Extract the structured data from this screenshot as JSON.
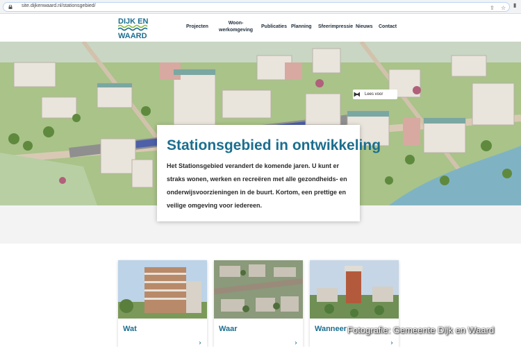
{
  "browser": {
    "url": "site.dijkenwaard.nl/stationsgebied/",
    "share_icon": "share-icon",
    "star_icon": "star-icon",
    "sidebar_icon": "sidebar-icon"
  },
  "site": {
    "logo_text": "DIJK EN WAARD",
    "nav": [
      "Projecten",
      "Woon-\nwerkomgeving",
      "Publicaties",
      "Planning",
      "Sfeerimpressie",
      "Nieuws",
      "Contact"
    ]
  },
  "hero": {
    "read_aloud_label": "Lees voor"
  },
  "intro": {
    "title": "Stationsgebied in ontwikkeling",
    "text": "Het Stationsgebied verandert de komende jaren. U kunt er straks wonen, werken en recreëren met alle gezondheids- en onderwijsvoorzieningen in de buurt. Kortom, een prettige en veilige omgeving voor iedereen."
  },
  "cards": [
    {
      "label": "Wat"
    },
    {
      "label": "Waar"
    },
    {
      "label": "Wanneer"
    }
  ],
  "photo_credit": "Fotografie: Gemeente Dijk en Waard",
  "colors": {
    "brand_blue": "#1b6e8f",
    "brand_green": "#8cbf3f",
    "nav_text": "#1c2b3a"
  }
}
